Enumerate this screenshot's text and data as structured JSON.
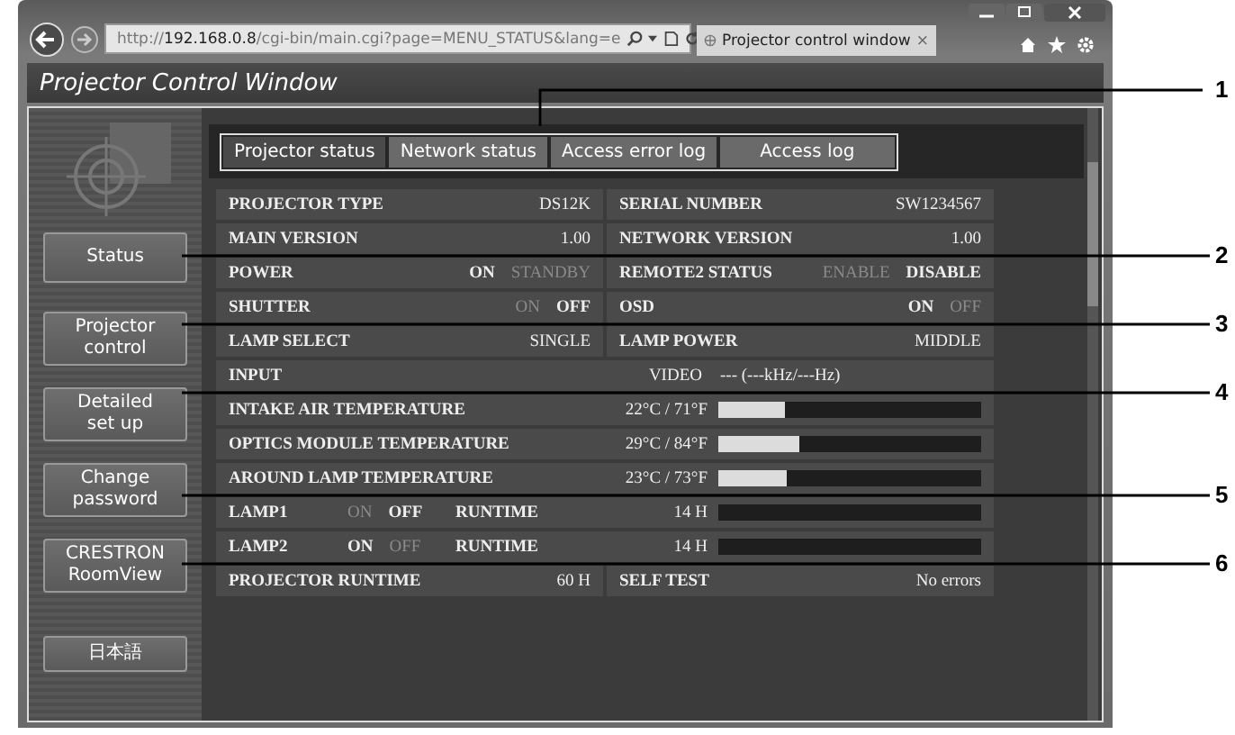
{
  "browser": {
    "address": "http://**192.168.0.8**/cgi-bin/main.cgi?page=MENU_STATUS&lang=e",
    "tab_title": "Projector control window",
    "tab_close": "×"
  },
  "window": {
    "title": "Projector Control Window"
  },
  "sidebar": {
    "buttons": [
      {
        "label": "Status"
      },
      {
        "label": "Projector\ncontrol"
      },
      {
        "label": "Detailed\nset up"
      },
      {
        "label": "Change\npassword"
      },
      {
        "label": "CRESTRON\nRoomView"
      },
      {
        "label": "日本語"
      }
    ]
  },
  "tabs": [
    {
      "label": "Projector status",
      "selected": true
    },
    {
      "label": "Network status",
      "selected": false
    },
    {
      "label": "Access error log",
      "selected": false
    },
    {
      "label": "Access log",
      "selected": false
    }
  ],
  "status_rows": [
    {
      "kind": "pair",
      "left": {
        "label": "PROJECTOR TYPE",
        "value": "DS12K"
      },
      "right": {
        "label": "SERIAL NUMBER",
        "value": "SW1234567"
      }
    },
    {
      "kind": "pair",
      "left": {
        "label": "MAIN VERSION",
        "value": "1.00"
      },
      "right": {
        "label": "NETWORK VERSION",
        "value": "1.00"
      }
    },
    {
      "kind": "pair",
      "left": {
        "label": "POWER",
        "options": [
          {
            "text": "ON",
            "selected": true
          },
          {
            "text": "STANDBY",
            "selected": false
          }
        ]
      },
      "right": {
        "label": "REMOTE2 STATUS",
        "options": [
          {
            "text": "ENABLE",
            "selected": false
          },
          {
            "text": "DISABLE",
            "selected": true
          }
        ]
      }
    },
    {
      "kind": "pair",
      "left": {
        "label": "SHUTTER",
        "options": [
          {
            "text": "ON",
            "selected": false
          },
          {
            "text": "OFF",
            "selected": true
          }
        ]
      },
      "right": {
        "label": "OSD",
        "options": [
          {
            "text": "ON",
            "selected": true
          },
          {
            "text": "OFF",
            "selected": false
          }
        ]
      }
    },
    {
      "kind": "pair",
      "left": {
        "label": "LAMP SELECT",
        "value": "SINGLE"
      },
      "right": {
        "label": "LAMP POWER",
        "value": "MIDDLE"
      }
    },
    {
      "kind": "input",
      "label": "INPUT",
      "source": "VIDEO",
      "signal": "--- (---kHz/---Hz)"
    },
    {
      "kind": "temp",
      "label": "INTAKE AIR TEMPERATURE",
      "reading": "22°C / 71°F",
      "level": 0.25
    },
    {
      "kind": "temp",
      "label": "OPTICS MODULE TEMPERATURE",
      "reading": "29°C / 84°F",
      "level": 0.31
    },
    {
      "kind": "temp",
      "label": "AROUND LAMP TEMPERATURE",
      "reading": "23°C / 73°F",
      "level": 0.26
    },
    {
      "kind": "lamp",
      "label": "LAMP1",
      "options": [
        {
          "text": "ON",
          "selected": false
        },
        {
          "text": "OFF",
          "selected": true
        }
      ],
      "runtime_label": "RUNTIME",
      "reading": "14 H"
    },
    {
      "kind": "lamp",
      "label": "LAMP2",
      "options": [
        {
          "text": "ON",
          "selected": true
        },
        {
          "text": "OFF",
          "selected": false
        }
      ],
      "runtime_label": "RUNTIME",
      "reading": "14 H"
    },
    {
      "kind": "pair",
      "left": {
        "label": "PROJECTOR RUNTIME",
        "value": "60 H"
      },
      "right": {
        "label": "SELF TEST",
        "value": "No errors"
      }
    }
  ],
  "callouts": [
    "1",
    "2",
    "3",
    "4",
    "5",
    "6"
  ]
}
